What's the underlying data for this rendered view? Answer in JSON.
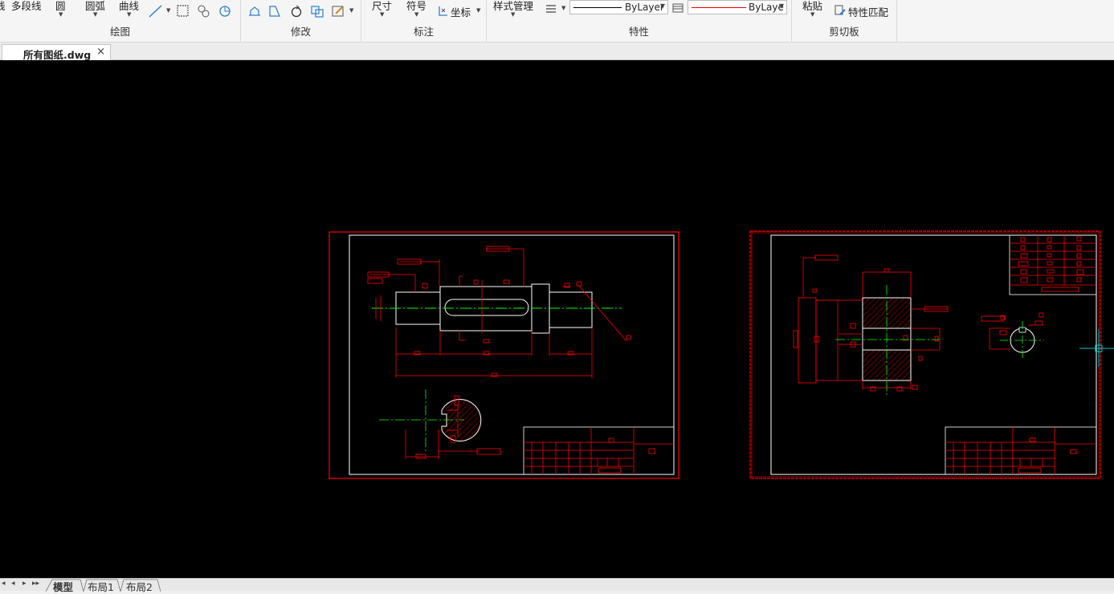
{
  "ribbon": {
    "draw": {
      "label": "绘图",
      "polyline": "多段线",
      "circle": "圆",
      "arc": "圆弧",
      "curve": "曲线",
      "partial": "线"
    },
    "modify": {
      "label": "修改"
    },
    "annotate": {
      "label": "标注",
      "dimension": "尺寸",
      "symbol": "符号",
      "coordinate": "坐标"
    },
    "properties": {
      "label": "特性",
      "style_manager": "样式管理",
      "linetype_value": "ByLayer",
      "color_value": "ByLaye"
    },
    "clipboard": {
      "label": "剪切板",
      "paste": "粘贴",
      "match_properties": "特性匹配"
    }
  },
  "document_tab": {
    "title": "所有图纸.dwg",
    "close": "×"
  },
  "layout_tabs": {
    "nav": [
      "◂",
      "◂",
      "▸",
      "▸▸"
    ],
    "tabs": [
      "模型",
      "布局1",
      "布局2"
    ],
    "active": "模型"
  },
  "colors": {
    "canvas_bg": "#000000",
    "drawing_red": "#ff0000",
    "drawing_white": "#ffffff",
    "centerline_green": "#00ff00",
    "cursor_cyan": "#00c8c8",
    "ribbon_bg": "#f5f5f5"
  }
}
